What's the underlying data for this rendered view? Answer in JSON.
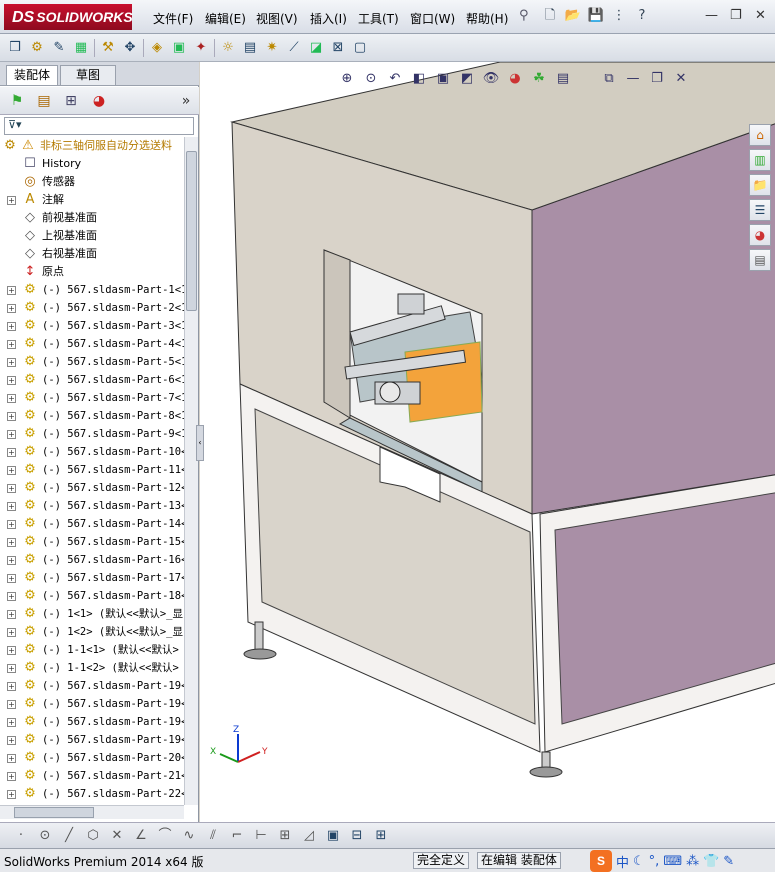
{
  "app": {
    "logo_text": "SOLIDWORKS",
    "logo_prefix": "DS"
  },
  "menu": [
    "文件(F)",
    "编辑(E)",
    "视图(V)",
    "插入(I)",
    "工具(T)",
    "窗口(W)",
    "帮助(H)"
  ],
  "left_tabs": {
    "assembly": "装配体",
    "sketch": "草图"
  },
  "tree": {
    "root": "非标三轴伺服自动分选送料",
    "items": [
      {
        "label": "History",
        "type": "history",
        "expand": false
      },
      {
        "label": "传感器",
        "type": "sensor",
        "expand": false
      },
      {
        "label": "注解",
        "type": "annotation",
        "expand": true
      },
      {
        "label": "前视基准面",
        "type": "plane",
        "expand": false
      },
      {
        "label": "上视基准面",
        "type": "plane",
        "expand": false
      },
      {
        "label": "右视基准面",
        "type": "plane",
        "expand": false
      },
      {
        "label": "原点",
        "type": "origin",
        "expand": false
      },
      {
        "label": "(-) 567.sldasm-Part-1<1",
        "type": "part",
        "expand": true
      },
      {
        "label": "(-) 567.sldasm-Part-2<1",
        "type": "part",
        "expand": true
      },
      {
        "label": "(-) 567.sldasm-Part-3<1",
        "type": "part",
        "expand": true
      },
      {
        "label": "(-) 567.sldasm-Part-4<1",
        "type": "part",
        "expand": true
      },
      {
        "label": "(-) 567.sldasm-Part-5<1",
        "type": "part",
        "expand": true
      },
      {
        "label": "(-) 567.sldasm-Part-6<1",
        "type": "part",
        "expand": true
      },
      {
        "label": "(-) 567.sldasm-Part-7<1",
        "type": "part",
        "expand": true
      },
      {
        "label": "(-) 567.sldasm-Part-8<1",
        "type": "part",
        "expand": true
      },
      {
        "label": "(-) 567.sldasm-Part-9<1",
        "type": "part",
        "expand": true
      },
      {
        "label": "(-) 567.sldasm-Part-10<",
        "type": "part",
        "expand": true
      },
      {
        "label": "(-) 567.sldasm-Part-11<",
        "type": "part",
        "expand": true
      },
      {
        "label": "(-) 567.sldasm-Part-12<",
        "type": "part",
        "expand": true
      },
      {
        "label": "(-) 567.sldasm-Part-13<",
        "type": "part",
        "expand": true
      },
      {
        "label": "(-) 567.sldasm-Part-14<",
        "type": "part",
        "expand": true
      },
      {
        "label": "(-) 567.sldasm-Part-15<",
        "type": "part",
        "expand": true
      },
      {
        "label": "(-) 567.sldasm-Part-16<",
        "type": "part",
        "expand": true
      },
      {
        "label": "(-) 567.sldasm-Part-17<",
        "type": "part",
        "expand": true
      },
      {
        "label": "(-) 567.sldasm-Part-18<",
        "type": "part",
        "expand": true
      },
      {
        "label": "(-) 1<1> (默认<<默认>_显",
        "type": "part",
        "expand": true
      },
      {
        "label": "(-) 1<2> (默认<<默认>_显",
        "type": "part",
        "expand": true
      },
      {
        "label": "(-) 1-1<1> (默认<<默认>",
        "type": "part",
        "expand": true
      },
      {
        "label": "(-) 1-1<2> (默认<<默认>",
        "type": "part",
        "expand": true
      },
      {
        "label": "(-) 567.sldasm-Part-19<",
        "type": "part",
        "expand": true
      },
      {
        "label": "(-) 567.sldasm-Part-19<",
        "type": "part",
        "expand": true
      },
      {
        "label": "(-) 567.sldasm-Part-19<",
        "type": "part",
        "expand": true
      },
      {
        "label": "(-) 567.sldasm-Part-19<",
        "type": "part",
        "expand": true
      },
      {
        "label": "(-) 567.sldasm-Part-20<",
        "type": "part",
        "expand": true
      },
      {
        "label": "(-) 567.sldasm-Part-21<",
        "type": "part",
        "expand": true
      },
      {
        "label": "(-) 567.sldasm-Part-22<",
        "type": "part",
        "expand": true
      }
    ]
  },
  "triad": {
    "x": "X",
    "y": "Y",
    "z": "Z"
  },
  "status": {
    "version": "SolidWorks Premium 2014 x64 版",
    "defined": "完全定义",
    "editing": "在编辑 装配体"
  },
  "ime": {
    "mode": "中"
  },
  "colors": {
    "logo_red": "#c8102e",
    "machine_purple": "#a98fa6",
    "machine_beige": "#d9d3c9",
    "frame_white": "#f4f2f0",
    "conveyor_orange": "#f3a33b"
  }
}
